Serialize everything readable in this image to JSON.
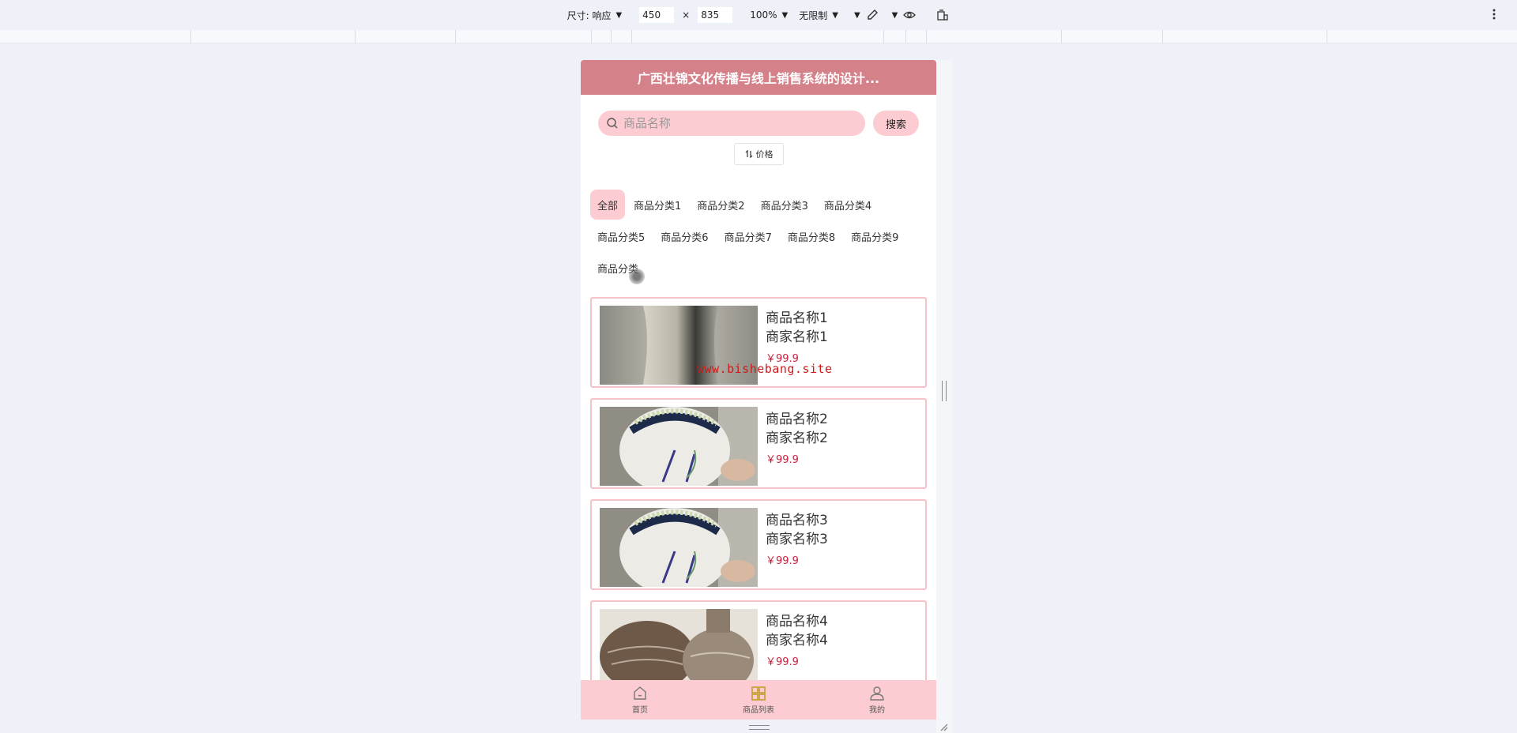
{
  "devtools": {
    "dimensions_label": "尺寸: 响应",
    "width_value": "450",
    "times_sign": "×",
    "height_value": "835",
    "zoom": "100%",
    "throttle": "无限制"
  },
  "app": {
    "title": "广西壮锦文化传播与线上销售系统的设计...",
    "search": {
      "placeholder": "商品名称",
      "button_label": "搜索"
    },
    "sort": {
      "label": "价格",
      "icon": "sort-arrows-icon"
    },
    "categories": [
      {
        "label": "全部",
        "active": true
      },
      {
        "label": "商品分类1"
      },
      {
        "label": "商品分类2"
      },
      {
        "label": "商品分类3"
      },
      {
        "label": "商品分类4"
      },
      {
        "label": "商品分类5"
      },
      {
        "label": "商品分类6"
      },
      {
        "label": "商品分类7"
      },
      {
        "label": "商品分类8"
      },
      {
        "label": "商品分类9"
      },
      {
        "label": "商品分类"
      }
    ],
    "products": [
      {
        "name": "商品名称1",
        "merchant": "商家名称1",
        "price": "￥99.9",
        "image": "gray-vase"
      },
      {
        "name": "商品名称2",
        "merchant": "商家名称2",
        "price": "￥99.9",
        "image": "painted-jar"
      },
      {
        "name": "商品名称3",
        "merchant": "商家名称3",
        "price": "￥99.9",
        "image": "painted-jar"
      },
      {
        "name": "商品名称4",
        "merchant": "商家名称4",
        "price": "￥99.9",
        "image": "brown-pots"
      }
    ],
    "watermark": "www.bishebang.site",
    "tabbar": [
      {
        "label": "首页",
        "icon": "home-icon"
      },
      {
        "label": "商品列表",
        "icon": "grid-icon"
      },
      {
        "label": "我的",
        "icon": "user-icon"
      }
    ],
    "colors": {
      "header": "#d4818a",
      "accent_pink": "#fcccd2",
      "card_border": "#f6c2c9",
      "price": "#c81e3c",
      "active_tab_icon": "#c8a23c"
    }
  }
}
